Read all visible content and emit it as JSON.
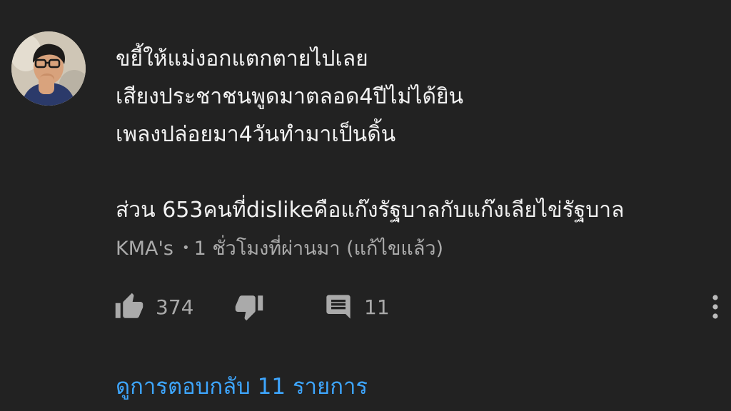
{
  "comment": {
    "avatar_icon": "user-avatar-photo",
    "text_lines": [
      "ขยี้ให้แม่งอกแตกตายไปเลย",
      "เสียงประชาชนพูดมาตลอด4ปีไม่ได้ยิน",
      "เพลงปล่อยมา4วันทำมาเป็นดิ้น",
      "",
      "ส่วน 653คนที่dislikeคือแก๊งรัฐบาลกับแก๊งเลียไข่รัฐบาล"
    ],
    "author": "KMA's",
    "separator": "•",
    "time": "1 ชั่วโมงที่ผ่านมา (แก้ไขแล้ว)"
  },
  "actions": {
    "like_icon": "thumbs-up-icon",
    "like_count": "374",
    "dislike_icon": "thumbs-down-icon",
    "reply_icon": "comment-icon",
    "reply_count": "11",
    "more_icon": "more-vertical-icon"
  },
  "replies": {
    "label": "ดูการตอบกลับ 11 รายการ"
  },
  "colors": {
    "background": "#222222",
    "text": "#f1f1f1",
    "secondary": "#aaaaaa",
    "link": "#3ea6ff"
  }
}
